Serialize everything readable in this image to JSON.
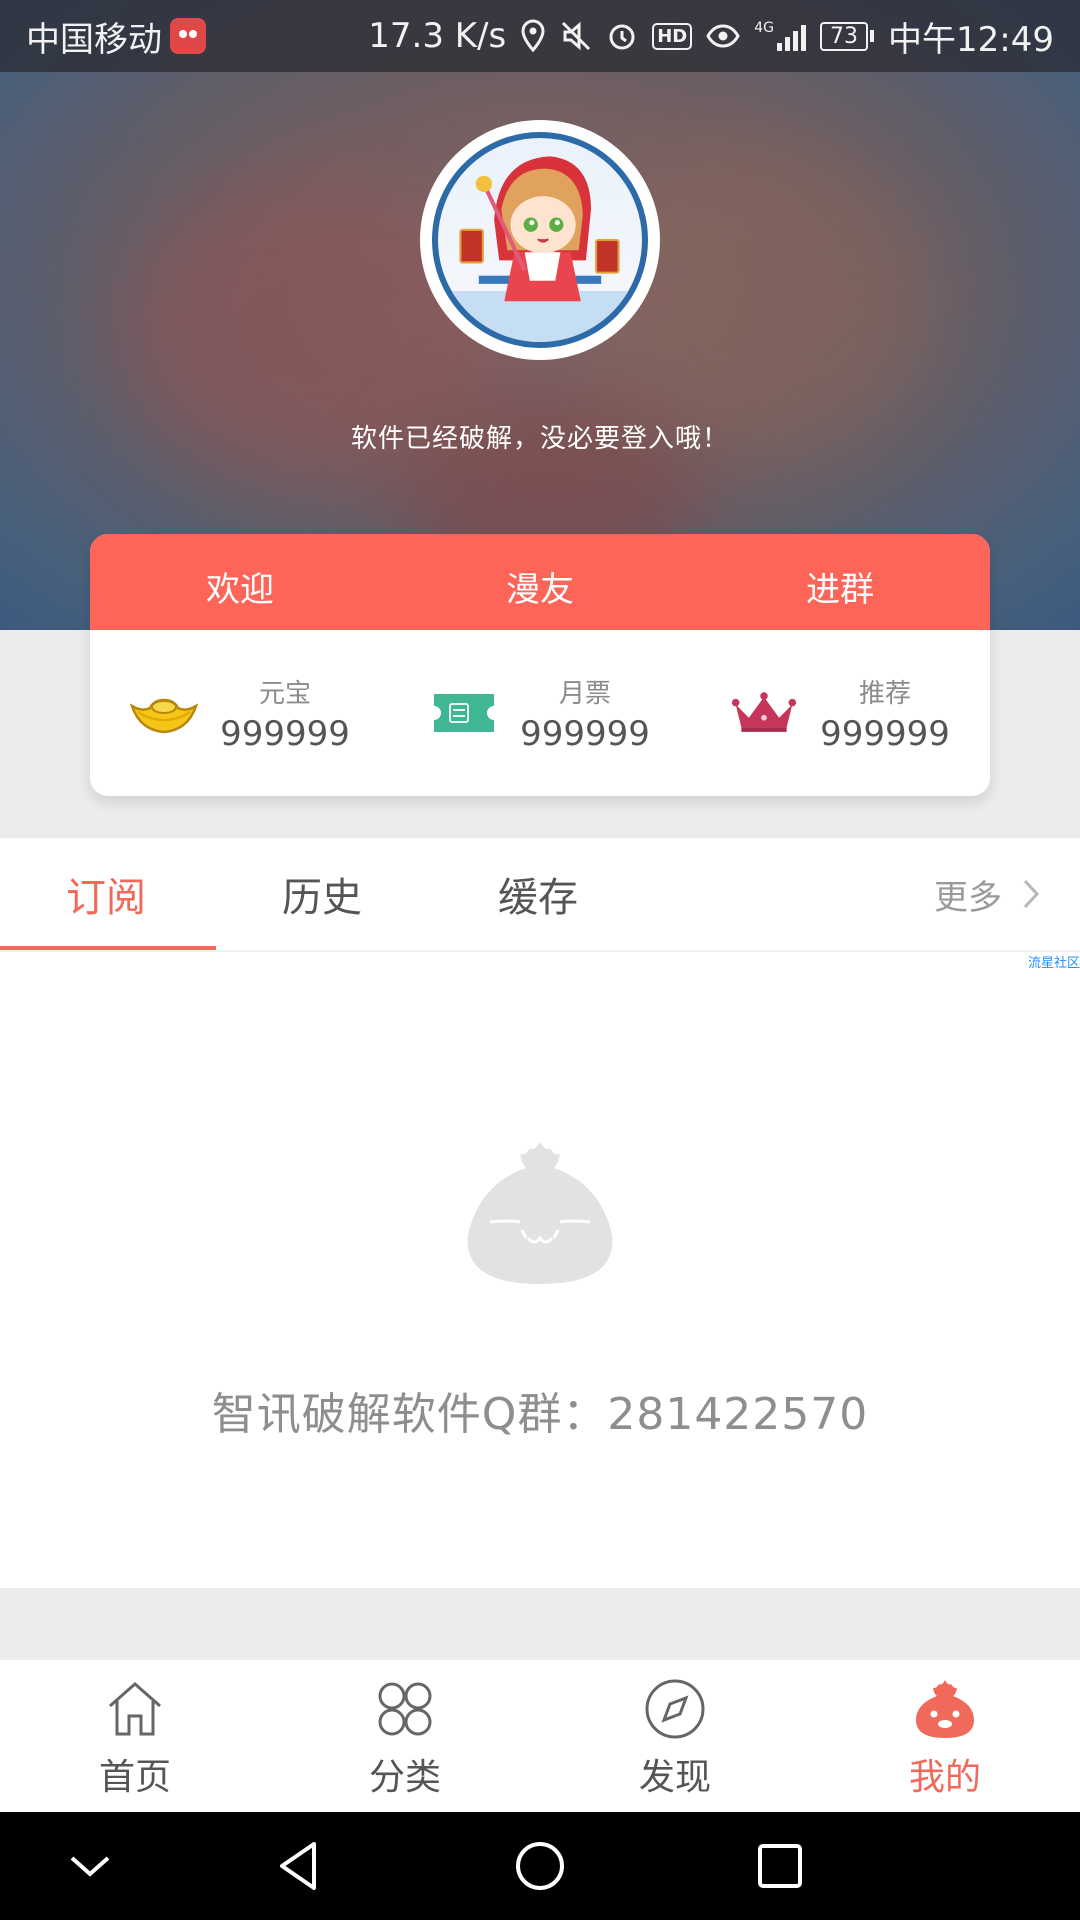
{
  "status_bar": {
    "carrier": "中国移动",
    "speed": "17.3 K/s",
    "network": "4G",
    "battery": "73",
    "time": "中午12:49"
  },
  "profile": {
    "tagline": "软件已经破解，没必要登入哦！"
  },
  "card": {
    "tabs": [
      "欢迎",
      "漫友",
      "进群"
    ],
    "stats": [
      {
        "label": "元宝",
        "value": "999999",
        "icon": "gold-ingot-icon"
      },
      {
        "label": "月票",
        "value": "999999",
        "icon": "ticket-icon"
      },
      {
        "label": "推荐",
        "value": "999999",
        "icon": "crown-icon"
      }
    ]
  },
  "content_tabs": {
    "items": [
      "订阅",
      "历史",
      "缓存"
    ],
    "active": "订阅",
    "more": "更多"
  },
  "content": {
    "watermark": "流星社区",
    "message": "智讯破解软件Q群：281422570"
  },
  "bottom_nav": {
    "items": [
      {
        "label": "首页",
        "icon": "home-icon"
      },
      {
        "label": "分类",
        "icon": "category-icon"
      },
      {
        "label": "发现",
        "icon": "compass-icon"
      },
      {
        "label": "我的",
        "icon": "mascot-icon"
      }
    ],
    "active": "我的"
  },
  "colors": {
    "accent": "#f0695a",
    "card_header": "#fc6557"
  }
}
